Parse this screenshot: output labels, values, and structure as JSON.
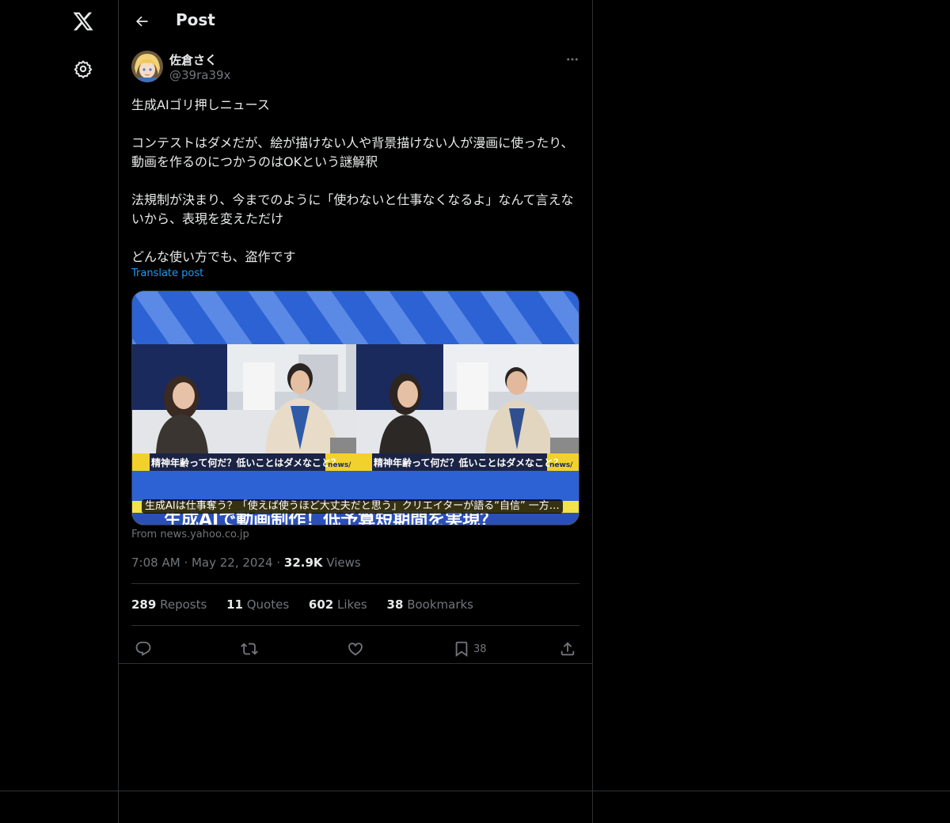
{
  "header": {
    "title": "Post"
  },
  "author": {
    "name": "佐倉さく",
    "handle": "@39ra39x"
  },
  "post": {
    "text": "生成AIゴリ押しニュース\n\nコンテストはダメだが、絵が描けない人や背景描けない人が漫画に使ったり、動画を作るのにつかうのはOKという謎解釈\n\n法規制が決まり、今までのように「使わないと仕事なくなるよ」なんて言えないから、表現を変えただけ\n\nどんな使い方でも、盗作です",
    "translate_label": "Translate post"
  },
  "card": {
    "caption": "生成AIは仕事奪う？「使えば使うほど大丈夫だと思う」クリエイターが語る“自信” 一方…",
    "source": "From news.yahoo.co.jp",
    "ticker_left": "精神年齢って何だ？低いことはダメなこと？",
    "ticker_right": "精神年齢って何だ？低いことはダメなこと？",
    "ticker_brand": "news/",
    "bottom_text": "生成AIで動画制作！低予算短期間を実現？"
  },
  "meta": {
    "time": "7:08 AM",
    "date": "May 22, 2024",
    "views_count": "32.9K",
    "views_label": "Views"
  },
  "stats": {
    "reposts_count": "289",
    "reposts_label": "Reposts",
    "quotes_count": "11",
    "quotes_label": "Quotes",
    "likes_count": "602",
    "likes_label": "Likes",
    "bookmarks_count": "38",
    "bookmarks_label": "Bookmarks"
  },
  "actions": {
    "bookmark_count": "38"
  },
  "icons": [
    "x-logo-icon",
    "settings-icon",
    "back-arrow-icon",
    "more-icon",
    "reply-icon",
    "repost-icon",
    "like-icon",
    "bookmark-icon",
    "share-icon"
  ],
  "colors": {
    "background": "#000000",
    "text": "#e7e9ea",
    "secondary": "#71767b",
    "link": "#1d9bf0",
    "border": "#2f3336"
  }
}
